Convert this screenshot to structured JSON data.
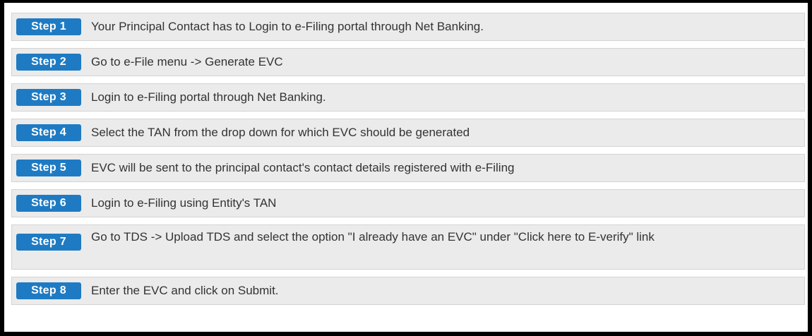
{
  "steps": [
    {
      "label": "Step 1",
      "text": "Your Principal Contact has to Login to e-Filing portal through Net Banking."
    },
    {
      "label": "Step 2",
      "text": "Go to e-File menu -> Generate EVC"
    },
    {
      "label": "Step 3",
      "text": "Login to e-Filing portal through Net Banking."
    },
    {
      "label": "Step 4",
      "text": "Select the TAN from the drop down for which EVC should be generated"
    },
    {
      "label": "Step 5",
      "text": "EVC will be sent to the principal contact's contact details registered with e-Filing"
    },
    {
      "label": "Step 6",
      "text": "Login to e-Filing using Entity's TAN"
    },
    {
      "label": "Step 7",
      "text": "Go to TDS -> Upload TDS and select the option \"I already have an EVC\" under \"Click here to E-verify\" link"
    },
    {
      "label": "Step 8",
      "text": "Enter the EVC and click on Submit."
    }
  ],
  "colors": {
    "badge": "#1e7bc3",
    "row_background": "#ebebeb",
    "frame": "#000000"
  }
}
